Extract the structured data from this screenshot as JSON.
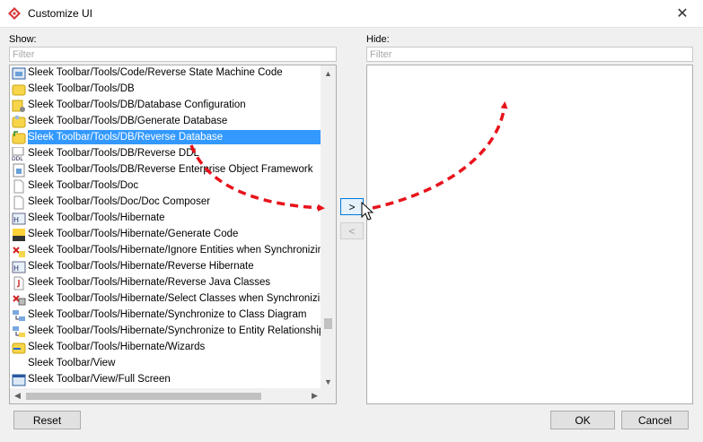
{
  "window": {
    "title": "Customize UI",
    "close_glyph": "✕"
  },
  "show": {
    "label": "Show:",
    "filter_placeholder": "Filter",
    "items": [
      {
        "label": "Sleek Toolbar/Tools/Code/Reverse State Machine Code",
        "icon": "state-machine-icon"
      },
      {
        "label": "Sleek Toolbar/Tools/DB",
        "icon": "folder-icon"
      },
      {
        "label": "Sleek Toolbar/Tools/DB/Database Configuration",
        "icon": "database-config-icon"
      },
      {
        "label": "Sleek Toolbar/Tools/DB/Generate Database",
        "icon": "generate-database-icon"
      },
      {
        "label": "Sleek Toolbar/Tools/DB/Reverse Database",
        "icon": "reverse-database-icon",
        "selected": true
      },
      {
        "label": "Sleek Toolbar/Tools/DB/Reverse DDL",
        "icon": "ddl-icon"
      },
      {
        "label": "Sleek Toolbar/Tools/DB/Reverse Enterprise Object Framework",
        "icon": "eof-icon"
      },
      {
        "label": "Sleek Toolbar/Tools/Doc",
        "icon": "document-icon"
      },
      {
        "label": "Sleek Toolbar/Tools/Doc/Doc Composer",
        "icon": "document-icon"
      },
      {
        "label": "Sleek Toolbar/Tools/Hibernate",
        "icon": "hibernate-icon"
      },
      {
        "label": "Sleek Toolbar/Tools/Hibernate/Generate Code",
        "icon": "code-icon"
      },
      {
        "label": "Sleek Toolbar/Tools/Hibernate/Ignore Entities when Synchronizing",
        "icon": "ignore-entities-icon"
      },
      {
        "label": "Sleek Toolbar/Tools/Hibernate/Reverse Hibernate",
        "icon": "hibernate-icon"
      },
      {
        "label": "Sleek Toolbar/Tools/Hibernate/Reverse Java Classes",
        "icon": "java-icon"
      },
      {
        "label": "Sleek Toolbar/Tools/Hibernate/Select Classes when Synchronizing",
        "icon": "select-classes-icon"
      },
      {
        "label": "Sleek Toolbar/Tools/Hibernate/Synchronize to Class Diagram",
        "icon": "sync-class-icon"
      },
      {
        "label": "Sleek Toolbar/Tools/Hibernate/Synchronize to Entity Relationship Dia",
        "icon": "sync-erd-icon"
      },
      {
        "label": "Sleek Toolbar/Tools/Hibernate/Wizards",
        "icon": "wizard-icon"
      },
      {
        "label": "Sleek Toolbar/View",
        "icon": ""
      },
      {
        "label": "Sleek Toolbar/View/Full Screen",
        "icon": "full-screen-icon"
      }
    ]
  },
  "hide": {
    "label": "Hide:",
    "filter_placeholder": "Filter"
  },
  "buttons": {
    "move_right": ">",
    "move_left": "<",
    "reset": "Reset",
    "ok": "OK",
    "cancel": "Cancel"
  },
  "scroll": {
    "up": "▲",
    "down": "▼",
    "left": "◀",
    "right": "▶"
  },
  "colors": {
    "selection": "#3399ff",
    "annotation": "#e8121b"
  }
}
